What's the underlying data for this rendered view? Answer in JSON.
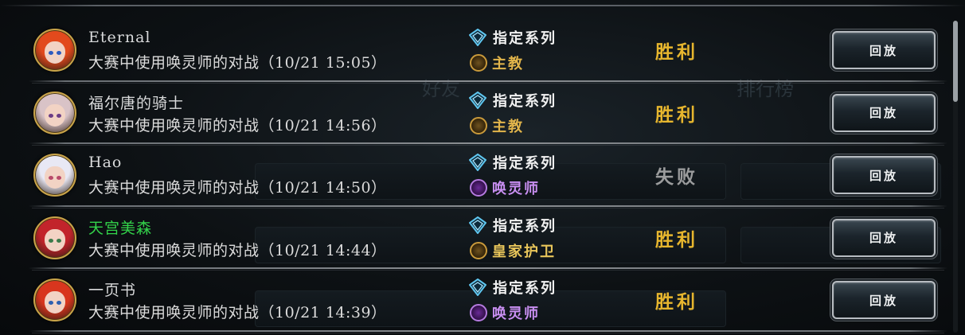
{
  "colors": {
    "win": "#e7b62e",
    "loss": "#9b9c9d",
    "name_normal": "#d9dadb",
    "name_highlight": "#33d34a",
    "bishop": "#e2b54b",
    "royal_guard": "#e8c55a",
    "summoner": "#c98ff2"
  },
  "matches": [
    {
      "player": "Eternal",
      "name_color": "normal",
      "desc": "大赛中使用唤灵师的对战（10/21 15:05）",
      "mode_icon": "diamond-shield-icon",
      "mode": "指定系列",
      "class_icon": "bishop-icon",
      "class_name": "主教",
      "class_color": "#e2b54b",
      "result": "胜利",
      "result_color": "#e7b62e",
      "replay": "回放",
      "avatar_hair": "#e24a1d",
      "avatar_eye": "#2c5ac0"
    },
    {
      "player": "福尔唐的骑士",
      "name_color": "normal",
      "desc": "大赛中使用唤灵师的对战（10/21 14:56）",
      "mode_icon": "diamond-shield-icon",
      "mode": "指定系列",
      "class_icon": "bishop-icon",
      "class_name": "主教",
      "class_color": "#e2b54b",
      "result": "胜利",
      "result_color": "#e7b62e",
      "replay": "回放",
      "avatar_hair": "#d9c3c7",
      "avatar_eye": "#6b3d86"
    },
    {
      "player": "Hao",
      "name_color": "normal",
      "desc": "大赛中使用唤灵师的对战（10/21 14:50）",
      "mode_icon": "diamond-shield-icon",
      "mode": "指定系列",
      "class_icon": "summoner-icon",
      "class_name": "唤灵师",
      "class_color": "#c98ff2",
      "result": "失败",
      "result_color": "#9b9c9d",
      "replay": "回放",
      "avatar_hair": "#e8e8f4",
      "avatar_eye": "#b84a6a"
    },
    {
      "player": "天宫美森",
      "name_color": "highlight",
      "desc": "大赛中使用唤灵师的对战（10/21 14:44）",
      "mode_icon": "diamond-shield-icon",
      "mode": "指定系列",
      "class_icon": "royal-guard-icon",
      "class_name": "皇家护卫",
      "class_color": "#e8c55a",
      "result": "胜利",
      "result_color": "#e7b62e",
      "replay": "回放",
      "avatar_hair": "#c2242b",
      "avatar_eye": "#3c7a4a"
    },
    {
      "player": "一页书",
      "name_color": "normal",
      "desc": "大赛中使用唤灵师的对战（10/21 14:39）",
      "mode_icon": "diamond-shield-icon",
      "mode": "指定系列",
      "class_icon": "summoner-icon",
      "class_name": "唤灵师",
      "class_color": "#c98ff2",
      "result": "胜利",
      "result_color": "#e7b62e",
      "replay": "回放",
      "avatar_hair": "#d8361e",
      "avatar_eye": "#2d5fb0"
    }
  ],
  "background": {
    "friends_tab": "好友",
    "ranking_tab": "排行榜"
  }
}
